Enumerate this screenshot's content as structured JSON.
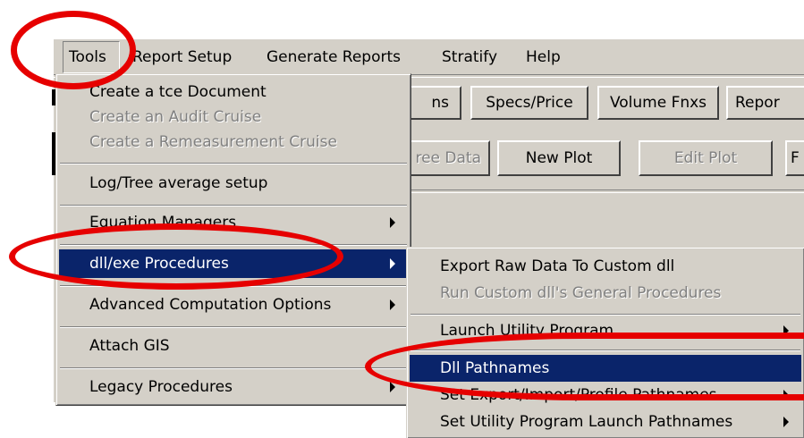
{
  "menubar": {
    "items": [
      "Tools",
      "Report Setup",
      "Generate Reports",
      "Stratify",
      "Help"
    ]
  },
  "toolbar": {
    "row1": [
      "ns",
      "Specs/Price",
      "Volume Fnxs",
      "Repor"
    ],
    "row2": [
      "ree Data",
      "New Plot",
      "Edit Plot",
      "F"
    ]
  },
  "tools_menu": {
    "items": [
      {
        "label": "Create a tce Document",
        "enabled": true
      },
      {
        "label": "Create an Audit Cruise",
        "enabled": false
      },
      {
        "label": "Create a Remeasurement Cruise",
        "enabled": false
      },
      {
        "label": "Log/Tree average setup",
        "enabled": true
      },
      {
        "label": "Equation Managers",
        "enabled": true,
        "submenu": true
      },
      {
        "label": "dll/exe Procedures",
        "enabled": true,
        "submenu": true,
        "highlighted": true
      },
      {
        "label": "Advanced Computation Options",
        "enabled": true,
        "submenu": true
      },
      {
        "label": "Attach GIS",
        "enabled": true
      },
      {
        "label": "Legacy Procedures",
        "enabled": true,
        "submenu": true
      }
    ]
  },
  "dll_submenu": {
    "items": [
      {
        "label": "Export Raw Data To Custom dll",
        "enabled": true
      },
      {
        "label": "Run Custom dll's General Procedures",
        "enabled": false
      },
      {
        "label": "Launch Utility Program",
        "enabled": true,
        "submenu": true
      },
      {
        "label": "Dll Pathnames",
        "enabled": true,
        "highlighted": true
      },
      {
        "label": "Set Export/Import/Profile Pathnames",
        "enabled": true,
        "submenu": true
      },
      {
        "label": "Set Utility Program Launch Pathnames",
        "enabled": true,
        "submenu": true
      }
    ]
  },
  "colors": {
    "highlight": "#0a246a",
    "annotation": "#e60000",
    "face": "#d4d0c8"
  }
}
